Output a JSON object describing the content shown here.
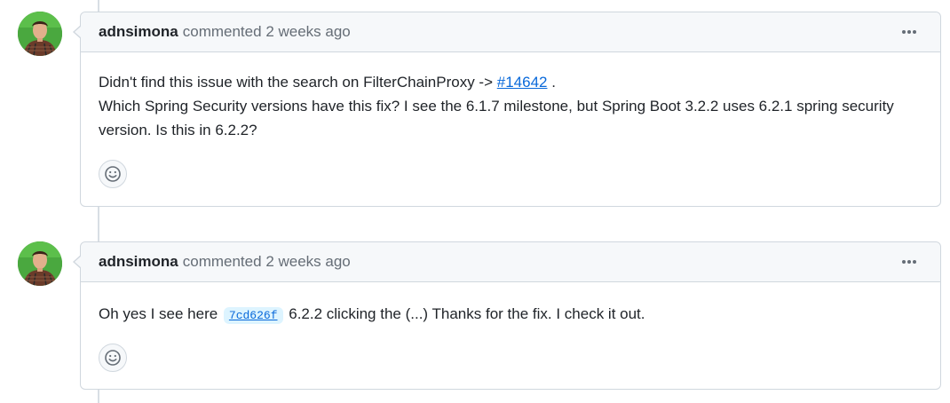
{
  "comments": [
    {
      "author": "adnsimona",
      "action": "commented",
      "time": "2 weeks ago",
      "menu_icon": "kebab-horizontal-icon",
      "body": {
        "line1_prefix": "Didn't find this issue with the search on FilterChainProxy -> ",
        "issue_ref": "#14642",
        "line1_suffix": " .",
        "line2": "Which Spring Security versions have this fix? I see the 6.1.7 milestone, but Spring Boot 3.2.2 uses 6.2.1 spring security version. Is this in 6.2.2?"
      },
      "reaction_icon": "smiley-icon"
    },
    {
      "author": "adnsimona",
      "action": "commented",
      "time": "2 weeks ago",
      "menu_icon": "kebab-horizontal-icon",
      "body": {
        "prefix": "Oh yes I see here ",
        "commit_ref": "7cd626f",
        "suffix": " 6.2.2 clicking the (...) Thanks for the fix. I check it out."
      },
      "reaction_icon": "smiley-icon"
    }
  ],
  "colors": {
    "link": "#0969da",
    "border": "#d0d7de",
    "header_bg": "#f6f8fa"
  }
}
